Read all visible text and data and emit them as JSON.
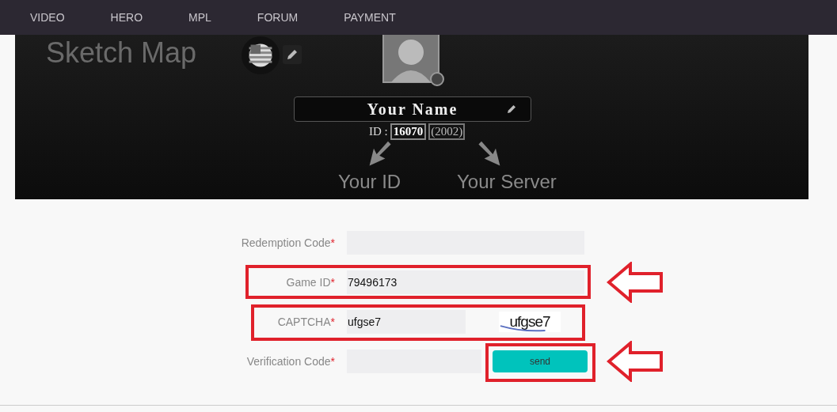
{
  "nav": [
    {
      "label": "VIDEO"
    },
    {
      "label": "HERO"
    },
    {
      "label": "MPL"
    },
    {
      "label": "FORUM"
    },
    {
      "label": "PAYMENT"
    }
  ],
  "banner": {
    "title": "Sketch Map",
    "name": "Your Name",
    "id_label": "ID :",
    "id_value": "16070",
    "server_value": "(2002)",
    "callouts": [
      "Your ID",
      "Your Server"
    ]
  },
  "form": {
    "fields": [
      {
        "kind": "text",
        "label": "Redemption Code",
        "required_mark": "*",
        "highlighted": false,
        "arrow": false
      },
      {
        "kind": "text",
        "label": "Game ID",
        "required_mark": "*",
        "value": "79496173",
        "highlighted": true,
        "arrow": true
      },
      {
        "kind": "captcha",
        "label": "CAPTCHA",
        "required_mark": "*",
        "value": "ufgse7",
        "captcha_text": "ufgse7",
        "highlighted": true,
        "arrow": false
      },
      {
        "kind": "verification",
        "label": "Verification Code",
        "required_mark": "*",
        "button": "send",
        "button_highlighted": true,
        "highlighted": false,
        "arrow": true
      }
    ]
  }
}
